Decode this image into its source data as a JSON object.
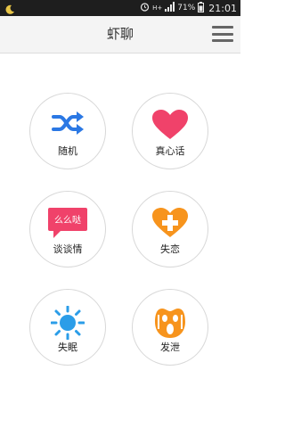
{
  "status_bar": {
    "time": "21:01",
    "battery": "71%",
    "network": "H+"
  },
  "header": {
    "title": "虾聊",
    "menu_icon": "hamburger-menu-icon"
  },
  "tiles": [
    {
      "label": "随机",
      "icon": "shuffle-icon",
      "color": "#2b78e4"
    },
    {
      "label": "真心话",
      "icon": "heart-icon",
      "color": "#f0426a"
    },
    {
      "label": "谈谈情",
      "icon": "speech-bubble-icon",
      "color": "#f0426a",
      "icon_text": "么么哒"
    },
    {
      "label": "失恋",
      "icon": "heart-plus-icon",
      "color": "#f7941d"
    },
    {
      "label": "失眠",
      "icon": "sun-moon-icon",
      "color": "#2b9de8"
    },
    {
      "label": "发泄",
      "icon": "scream-face-icon",
      "color": "#f7941d"
    }
  ]
}
